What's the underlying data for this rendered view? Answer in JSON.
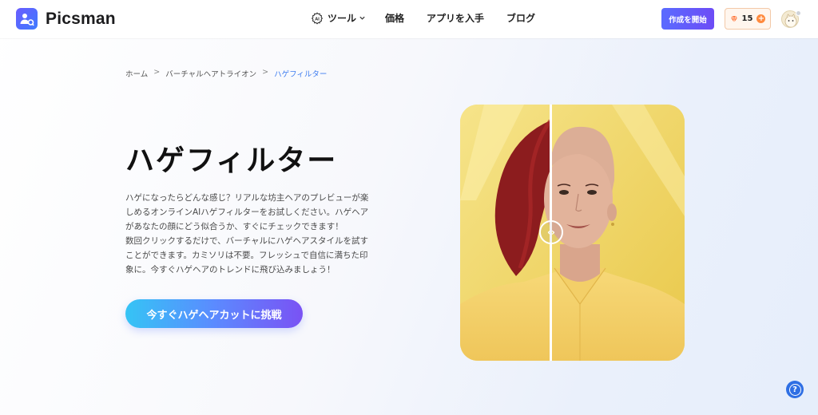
{
  "brand": {
    "name": "Picsman",
    "accent": "#5a6bff"
  },
  "nav": {
    "tools_label": "ツール",
    "pricing_label": "価格",
    "app_label": "アプリを入手",
    "blog_label": "ブログ"
  },
  "header": {
    "create_label": "作成を開始",
    "credits": "15"
  },
  "breadcrumb": [
    "ホーム",
    "バーチャルヘアトライオン",
    "ハゲフィルター"
  ],
  "breadcrumb_sep": ">",
  "hero": {
    "title": "ハゲフィルター",
    "description_lines": [
      "ハゲになったらどんな感じ？リアルな坊主ヘアのプレビューが楽",
      "しめるオンラインAIハゲフィルターをお試しください。ハゲヘア",
      "があなたの顔にどう似合うか、すぐにチェックできます！",
      "数回クリックするだけで、バーチャルにハゲヘアスタイルを試す",
      "ことができます。カミソリは不要。フレッシュで自信に満ちた印",
      "象に。今すぐハゲヘアのトレンドに飛び込みましょう！"
    ],
    "cta_label": "今すぐハゲヘアカットに挑戦"
  },
  "compare": {
    "handle_glyph": "‹›",
    "divider_position": 0.4
  },
  "help": {
    "glyph": "?"
  }
}
